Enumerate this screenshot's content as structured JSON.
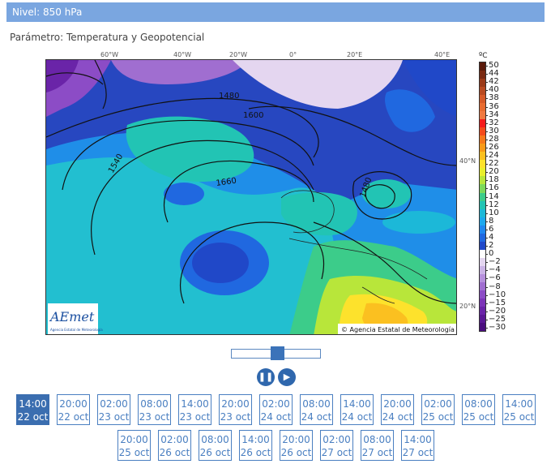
{
  "header": {
    "title": "Nivel: 850 hPa"
  },
  "parameter": {
    "text": "Parámetro: Temperatura y Geopotencial"
  },
  "map": {
    "lon_labels": [
      "60°W",
      "40°W",
      "20°W",
      "0°",
      "20°E",
      "40°E"
    ],
    "lat_labels": [
      "40°N",
      "20°N"
    ],
    "contour_labels": [
      "1480",
      "1600",
      "1540",
      "1660",
      "1480"
    ],
    "copyright": "© Agencia Estatal de Meteorología",
    "logo_text": "AEmet",
    "logo_subtext": "Agencia Estatal de Meteorología"
  },
  "colorbar": {
    "unit": "ºC",
    "labels": [
      "50",
      "44",
      "42",
      "40",
      "38",
      "36",
      "34",
      "32",
      "30",
      "28",
      "26",
      "24",
      "22",
      "20",
      "18",
      "16",
      "14",
      "12",
      "10",
      "8",
      "6",
      "4",
      "2",
      "0",
      "−2",
      "−4",
      "−6",
      "−8",
      "−10",
      "−15",
      "−20",
      "−25",
      "−30"
    ],
    "colors": [
      "#5a1a0a",
      "#7a2a12",
      "#9a3a18",
      "#b84a20",
      "#d65a28",
      "#e86c30",
      "#f07a40",
      "#f51c1c",
      "#f44a1a",
      "#f6781a",
      "#f89a18",
      "#fbc020",
      "#fde22c",
      "#e8ef2c",
      "#b8e63a",
      "#7cd95a",
      "#3ccc8a",
      "#22c4b4",
      "#1cb8d8",
      "#1ca8ee",
      "#2088f0",
      "#2068e0",
      "#2048c8",
      "#ffffff",
      "#e4d6f0",
      "#cbb4e6",
      "#b690dc",
      "#a06ed0",
      "#8c4cc6",
      "#7c34b8",
      "#6a24a8",
      "#5a1894",
      "#4a0e7e"
    ]
  },
  "controls": {
    "pause_icon": "pause-icon",
    "play_icon": "play-icon",
    "slider_position": 0.52
  },
  "times": [
    {
      "hour": "14:00",
      "date": "22 oct"
    },
    {
      "hour": "20:00",
      "date": "22 oct"
    },
    {
      "hour": "02:00",
      "date": "23 oct"
    },
    {
      "hour": "08:00",
      "date": "23 oct"
    },
    {
      "hour": "14:00",
      "date": "23 oct"
    },
    {
      "hour": "20:00",
      "date": "23 oct"
    },
    {
      "hour": "02:00",
      "date": "24 oct"
    },
    {
      "hour": "08:00",
      "date": "24 oct"
    },
    {
      "hour": "14:00",
      "date": "24 oct"
    },
    {
      "hour": "20:00",
      "date": "24 oct"
    },
    {
      "hour": "02:00",
      "date": "25 oct"
    },
    {
      "hour": "08:00",
      "date": "25 oct"
    },
    {
      "hour": "14:00",
      "date": "25 oct"
    },
    {
      "hour": "20:00",
      "date": "25 oct"
    },
    {
      "hour": "02:00",
      "date": "26 oct"
    },
    {
      "hour": "08:00",
      "date": "26 oct"
    },
    {
      "hour": "14:00",
      "date": "26 oct"
    },
    {
      "hour": "20:00",
      "date": "26 oct"
    },
    {
      "hour": "02:00",
      "date": "27 oct"
    },
    {
      "hour": "08:00",
      "date": "27 oct"
    },
    {
      "hour": "14:00",
      "date": "27 oct"
    }
  ],
  "active_time_index": 0
}
